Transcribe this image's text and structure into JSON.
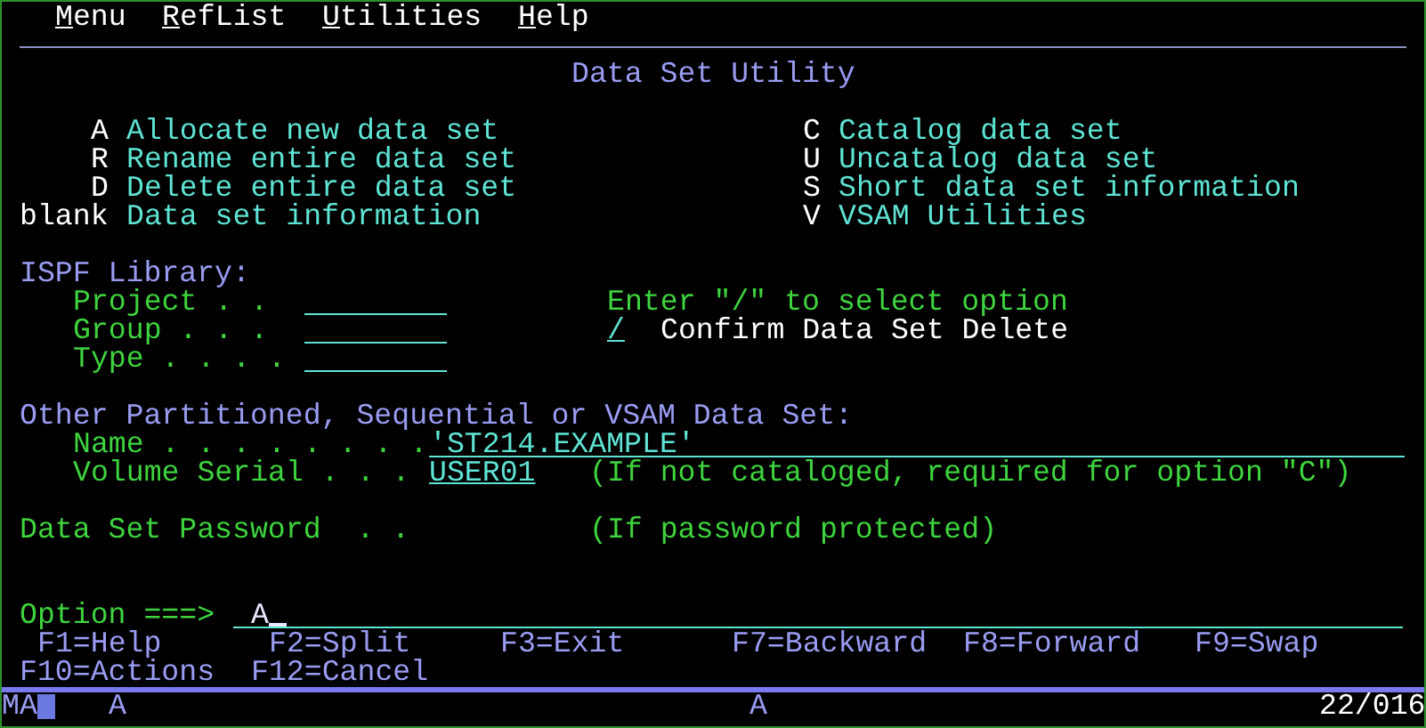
{
  "menu_bar": [
    {
      "label": "Menu"
    },
    {
      "label": "RefList"
    },
    {
      "label": "Utilities"
    },
    {
      "label": "Help"
    }
  ],
  "title": "Data Set Utility",
  "options_left": [
    {
      "key": "A",
      "label": "Allocate new data set"
    },
    {
      "key": "R",
      "label": "Rename entire data set"
    },
    {
      "key": "D",
      "label": "Delete entire data set"
    },
    {
      "key": "blank",
      "label": "Data set information"
    }
  ],
  "options_right": [
    {
      "key": "C",
      "label": "Catalog data set"
    },
    {
      "key": "U",
      "label": "Uncatalog data set"
    },
    {
      "key": "S",
      "label": "Short data set information"
    },
    {
      "key": "V",
      "label": "VSAM Utilities"
    }
  ],
  "ispf_library": {
    "heading": "ISPF Library:",
    "fields": [
      {
        "label": "Project . ."
      },
      {
        "label": "Group . . ."
      },
      {
        "label": "Type . . . ."
      }
    ]
  },
  "select_hint": "Enter \"/\" to select option",
  "confirm_delete": {
    "value": "/",
    "label": "Confirm Data Set Delete"
  },
  "other_data_set": {
    "heading": "Other Partitioned, Sequential or VSAM Data Set:",
    "name": {
      "label": "Name . . . . . . . .",
      "value": "'ST214.EXAMPLE'"
    },
    "volume_serial": {
      "label": "Volume Serial . . .",
      "value": "USER01",
      "note": "(If not cataloged, required for option \"C\")"
    }
  },
  "password": {
    "label": "Data Set Password  . .",
    "note": "(If password protected)"
  },
  "command": {
    "label": "Option ===>",
    "value": "A"
  },
  "function_keys": [
    [
      "F1=Help",
      "F2=Split",
      "F3=Exit",
      "F7=Backward",
      "F8=Forward",
      "F9=Swap"
    ],
    [
      "F10=Actions",
      "F12=Cancel"
    ]
  ],
  "status_line": {
    "session": "MA",
    "field_1": "A",
    "field_2": "A",
    "cursor_position": "22/016"
  }
}
